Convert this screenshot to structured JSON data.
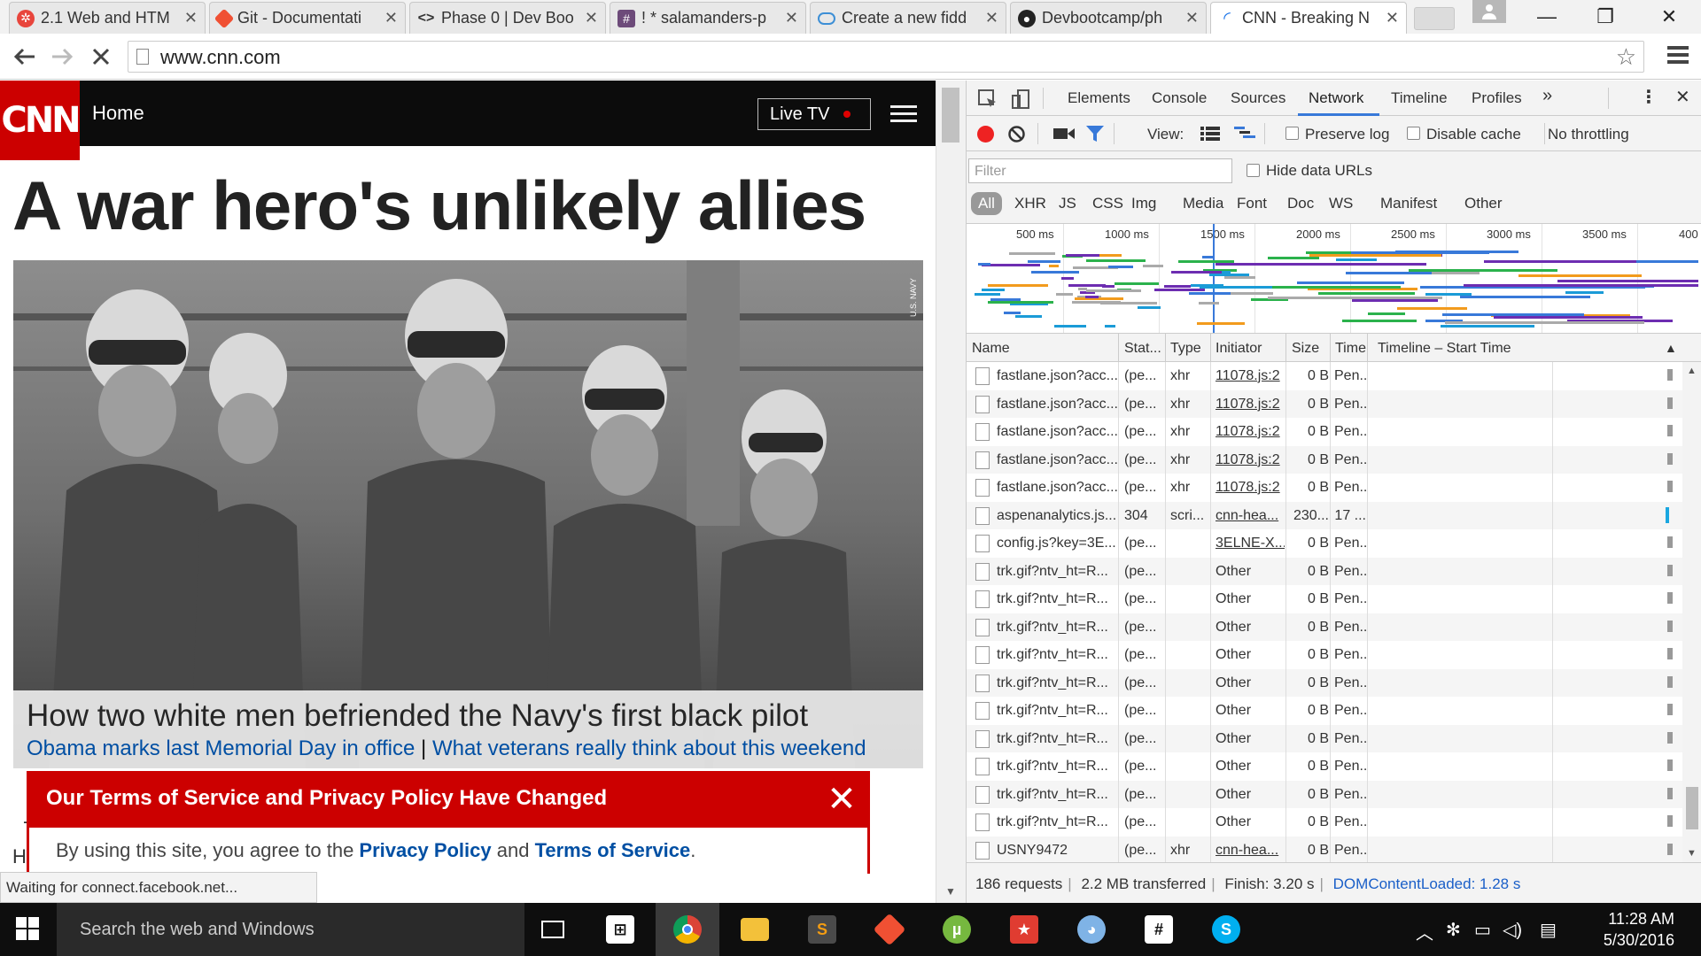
{
  "browser": {
    "tabs": [
      {
        "title": "2.1 Web and HTM",
        "color": "#e8453c"
      },
      {
        "title": "Git - Documentati",
        "color": "#f05033"
      },
      {
        "title": "Phase 0 | Dev Boo",
        "color": "#444444"
      },
      {
        "title": "! * salamanders-p",
        "color": "#6d4b7a"
      },
      {
        "title": "Create a new fidd",
        "color": "#3d8fd6"
      },
      {
        "title": "Devbootcamp/ph",
        "color": "#222222"
      },
      {
        "title": "CNN - Breaking N",
        "color": "#cc0000"
      }
    ],
    "active_tab_index": 6,
    "url": "www.cnn.com"
  },
  "cnn": {
    "logo": "CNN",
    "nav_home": "Home",
    "live_tv": "Live TV",
    "headline": "A war hero's unlikely allies",
    "photo_credit": "U.S. NAVY",
    "caption": "How two white men befriended the Navy's first black pilot",
    "sublink_1": "Obama marks last Memorial Day in office",
    "sublink_sep": "|",
    "sublink_2": "What veterans really think about this weekend",
    "tos_title": "Our Terms of Service and Privacy Policy Have Changed",
    "tos_text_1": "By using this site, you agree to the ",
    "tos_privacy": "Privacy Policy",
    "tos_text_2": " and ",
    "tos_terms": "Terms of Service",
    "tos_text_3": ".",
    "left_fragment_1": "-",
    "left_fragment_2": "H",
    "status_bubble": "Waiting for connect.facebook.net..."
  },
  "devtools": {
    "tabs": [
      "Elements",
      "Console",
      "Sources",
      "Network",
      "Timeline",
      "Profiles"
    ],
    "active_tab": "Network",
    "more": "»",
    "view_label": "View:",
    "preserve_log": "Preserve log",
    "disable_cache": "Disable cache",
    "throttling": "No throttling",
    "filter_placeholder": "Filter",
    "hide_data_urls": "Hide data URLs",
    "type_filters": [
      "All",
      "XHR",
      "JS",
      "CSS",
      "Img",
      "Media",
      "Font",
      "Doc",
      "WS",
      "Manifest",
      "Other"
    ],
    "ticks": [
      "500 ms",
      "1000 ms",
      "1500 ms",
      "2000 ms",
      "2500 ms",
      "3000 ms",
      "3500 ms",
      "400"
    ],
    "columns": [
      "Name",
      "Stat...",
      "Type",
      "Initiator",
      "Size",
      "Time",
      "Timeline – Start Time"
    ],
    "rows": [
      {
        "name": "fastlane.json?acc...",
        "status": "(pe...",
        "type": "xhr",
        "initiator": "11078.js:2",
        "size": "0 B",
        "time": "Pen...",
        "link": true
      },
      {
        "name": "fastlane.json?acc...",
        "status": "(pe...",
        "type": "xhr",
        "initiator": "11078.js:2",
        "size": "0 B",
        "time": "Pen...",
        "link": true
      },
      {
        "name": "fastlane.json?acc...",
        "status": "(pe...",
        "type": "xhr",
        "initiator": "11078.js:2",
        "size": "0 B",
        "time": "Pen...",
        "link": true
      },
      {
        "name": "fastlane.json?acc...",
        "status": "(pe...",
        "type": "xhr",
        "initiator": "11078.js:2",
        "size": "0 B",
        "time": "Pen...",
        "link": true
      },
      {
        "name": "fastlane.json?acc...",
        "status": "(pe...",
        "type": "xhr",
        "initiator": "11078.js:2",
        "size": "0 B",
        "time": "Pen...",
        "link": true
      },
      {
        "name": "aspenanalytics.js...",
        "status": "304",
        "type": "scri...",
        "initiator": "cnn-hea...",
        "size": "230...",
        "time": "17 ...",
        "link": true
      },
      {
        "name": "config.js?key=3E...",
        "status": "(pe...",
        "type": "",
        "initiator": "3ELNE-X...",
        "size": "0 B",
        "time": "Pen...",
        "link": true
      },
      {
        "name": "trk.gif?ntv_ht=R...",
        "status": "(pe...",
        "type": "",
        "initiator": "Other",
        "size": "0 B",
        "time": "Pen...",
        "link": false
      },
      {
        "name": "trk.gif?ntv_ht=R...",
        "status": "(pe...",
        "type": "",
        "initiator": "Other",
        "size": "0 B",
        "time": "Pen...",
        "link": false
      },
      {
        "name": "trk.gif?ntv_ht=R...",
        "status": "(pe...",
        "type": "",
        "initiator": "Other",
        "size": "0 B",
        "time": "Pen...",
        "link": false
      },
      {
        "name": "trk.gif?ntv_ht=R...",
        "status": "(pe...",
        "type": "",
        "initiator": "Other",
        "size": "0 B",
        "time": "Pen...",
        "link": false
      },
      {
        "name": "trk.gif?ntv_ht=R...",
        "status": "(pe...",
        "type": "",
        "initiator": "Other",
        "size": "0 B",
        "time": "Pen...",
        "link": false
      },
      {
        "name": "trk.gif?ntv_ht=R...",
        "status": "(pe...",
        "type": "",
        "initiator": "Other",
        "size": "0 B",
        "time": "Pen...",
        "link": false
      },
      {
        "name": "trk.gif?ntv_ht=R...",
        "status": "(pe...",
        "type": "",
        "initiator": "Other",
        "size": "0 B",
        "time": "Pen...",
        "link": false
      },
      {
        "name": "trk.gif?ntv_ht=R...",
        "status": "(pe...",
        "type": "",
        "initiator": "Other",
        "size": "0 B",
        "time": "Pen...",
        "link": false
      },
      {
        "name": "trk.gif?ntv_ht=R...",
        "status": "(pe...",
        "type": "",
        "initiator": "Other",
        "size": "0 B",
        "time": "Pen...",
        "link": false
      },
      {
        "name": "trk.gif?ntv_ht=R...",
        "status": "(pe...",
        "type": "",
        "initiator": "Other",
        "size": "0 B",
        "time": "Pen...",
        "link": false
      },
      {
        "name": "USNY9472",
        "status": "(pe...",
        "type": "xhr",
        "initiator": "cnn-hea...",
        "size": "0 B",
        "time": "Pen...",
        "link": true
      }
    ],
    "status_bar": {
      "requests": "186 requests",
      "transferred": "2.2 MB transferred",
      "finish": "Finish: 3.20 s",
      "dcl": "DOMContentLoaded: 1.28 s"
    }
  },
  "taskbar": {
    "search_text": "Search the web and Windows",
    "time": "11:28 AM",
    "date": "5/30/2016"
  }
}
